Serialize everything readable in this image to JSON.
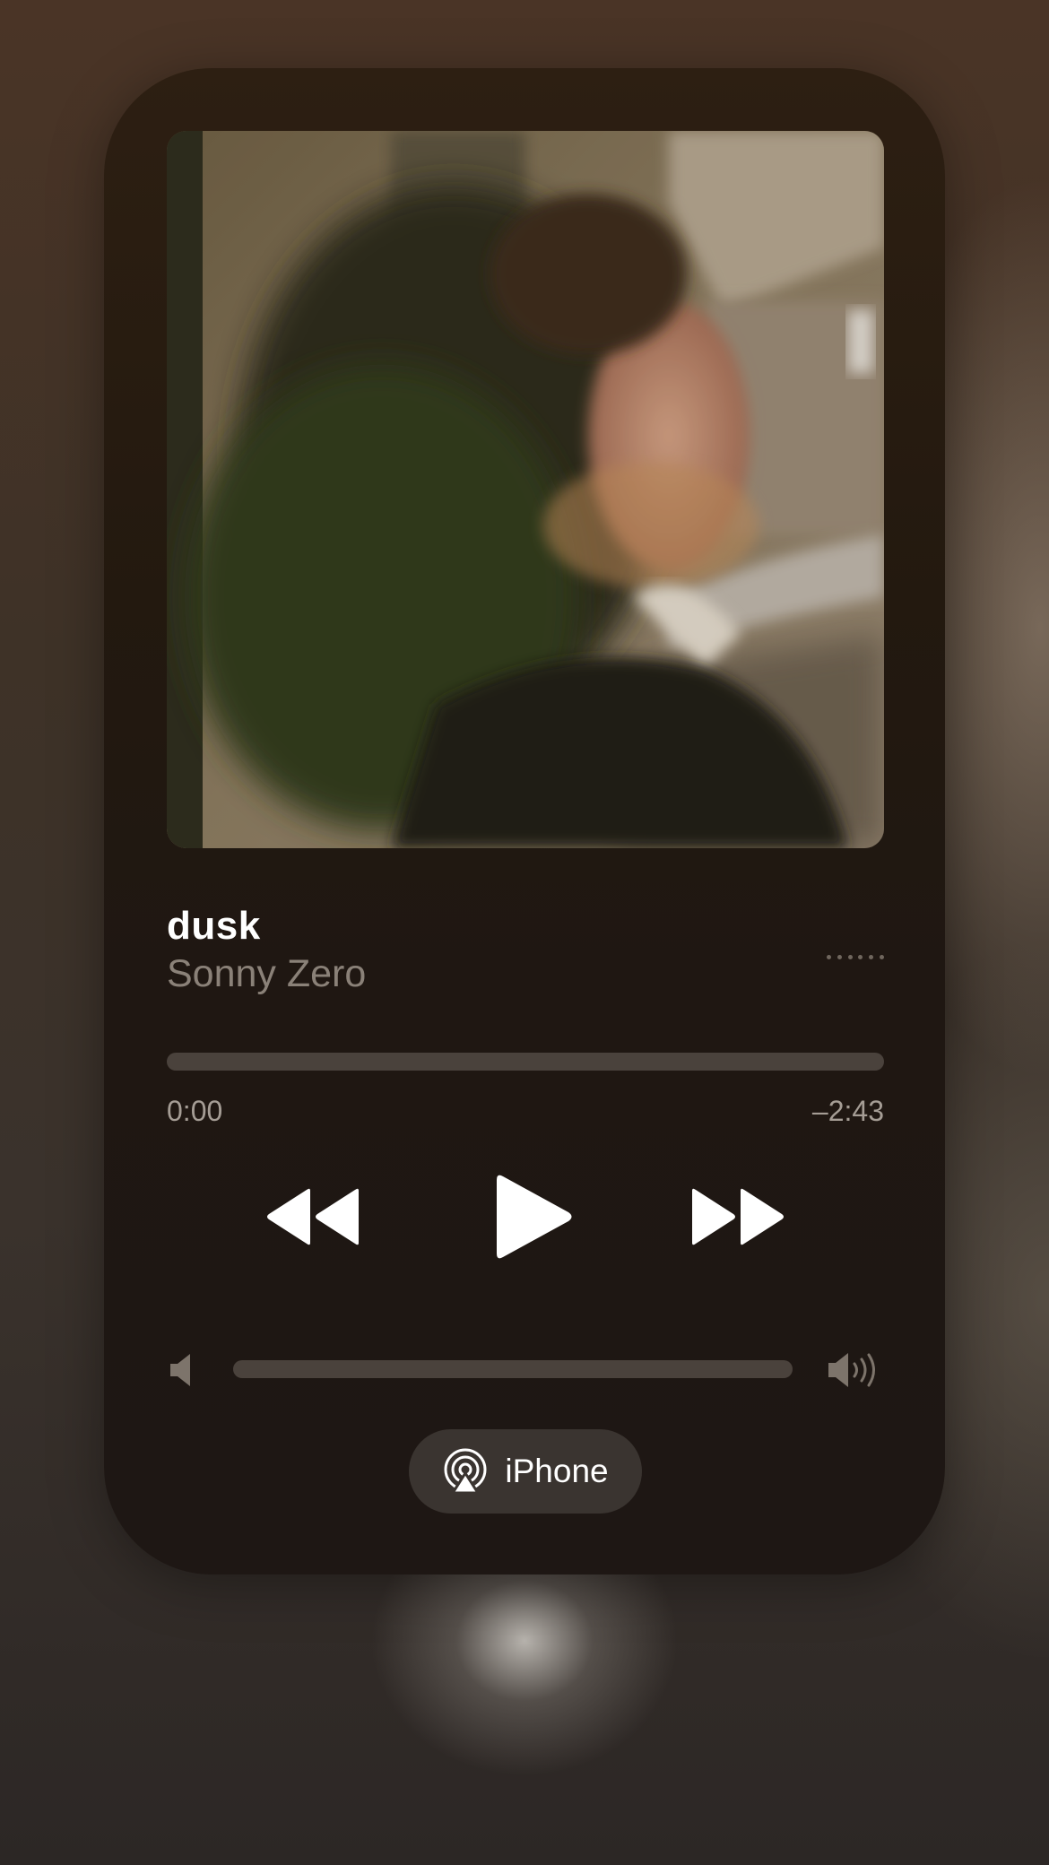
{
  "now_playing": {
    "title": "dusk",
    "artist": "Sonny Zero",
    "artwork_icon": "album-artwork"
  },
  "playback": {
    "elapsed": "0:00",
    "remaining": "–2:43",
    "progress_fraction": 0.0
  },
  "controls": {
    "rewind_icon": "backward-icon",
    "play_icon": "play-icon",
    "forward_icon": "forward-icon",
    "more_icon": "ellipsis-icon"
  },
  "volume": {
    "level_fraction": 0.0,
    "low_icon": "speaker-low-icon",
    "high_icon": "speaker-high-icon"
  },
  "output": {
    "label": "iPhone",
    "icon": "airplay-icon"
  },
  "colors": {
    "card_background": "#23190f",
    "title_text": "#ffffff",
    "artist_text": "#8a8178",
    "track": "#4a423c",
    "pill_background": "#3a3430"
  }
}
